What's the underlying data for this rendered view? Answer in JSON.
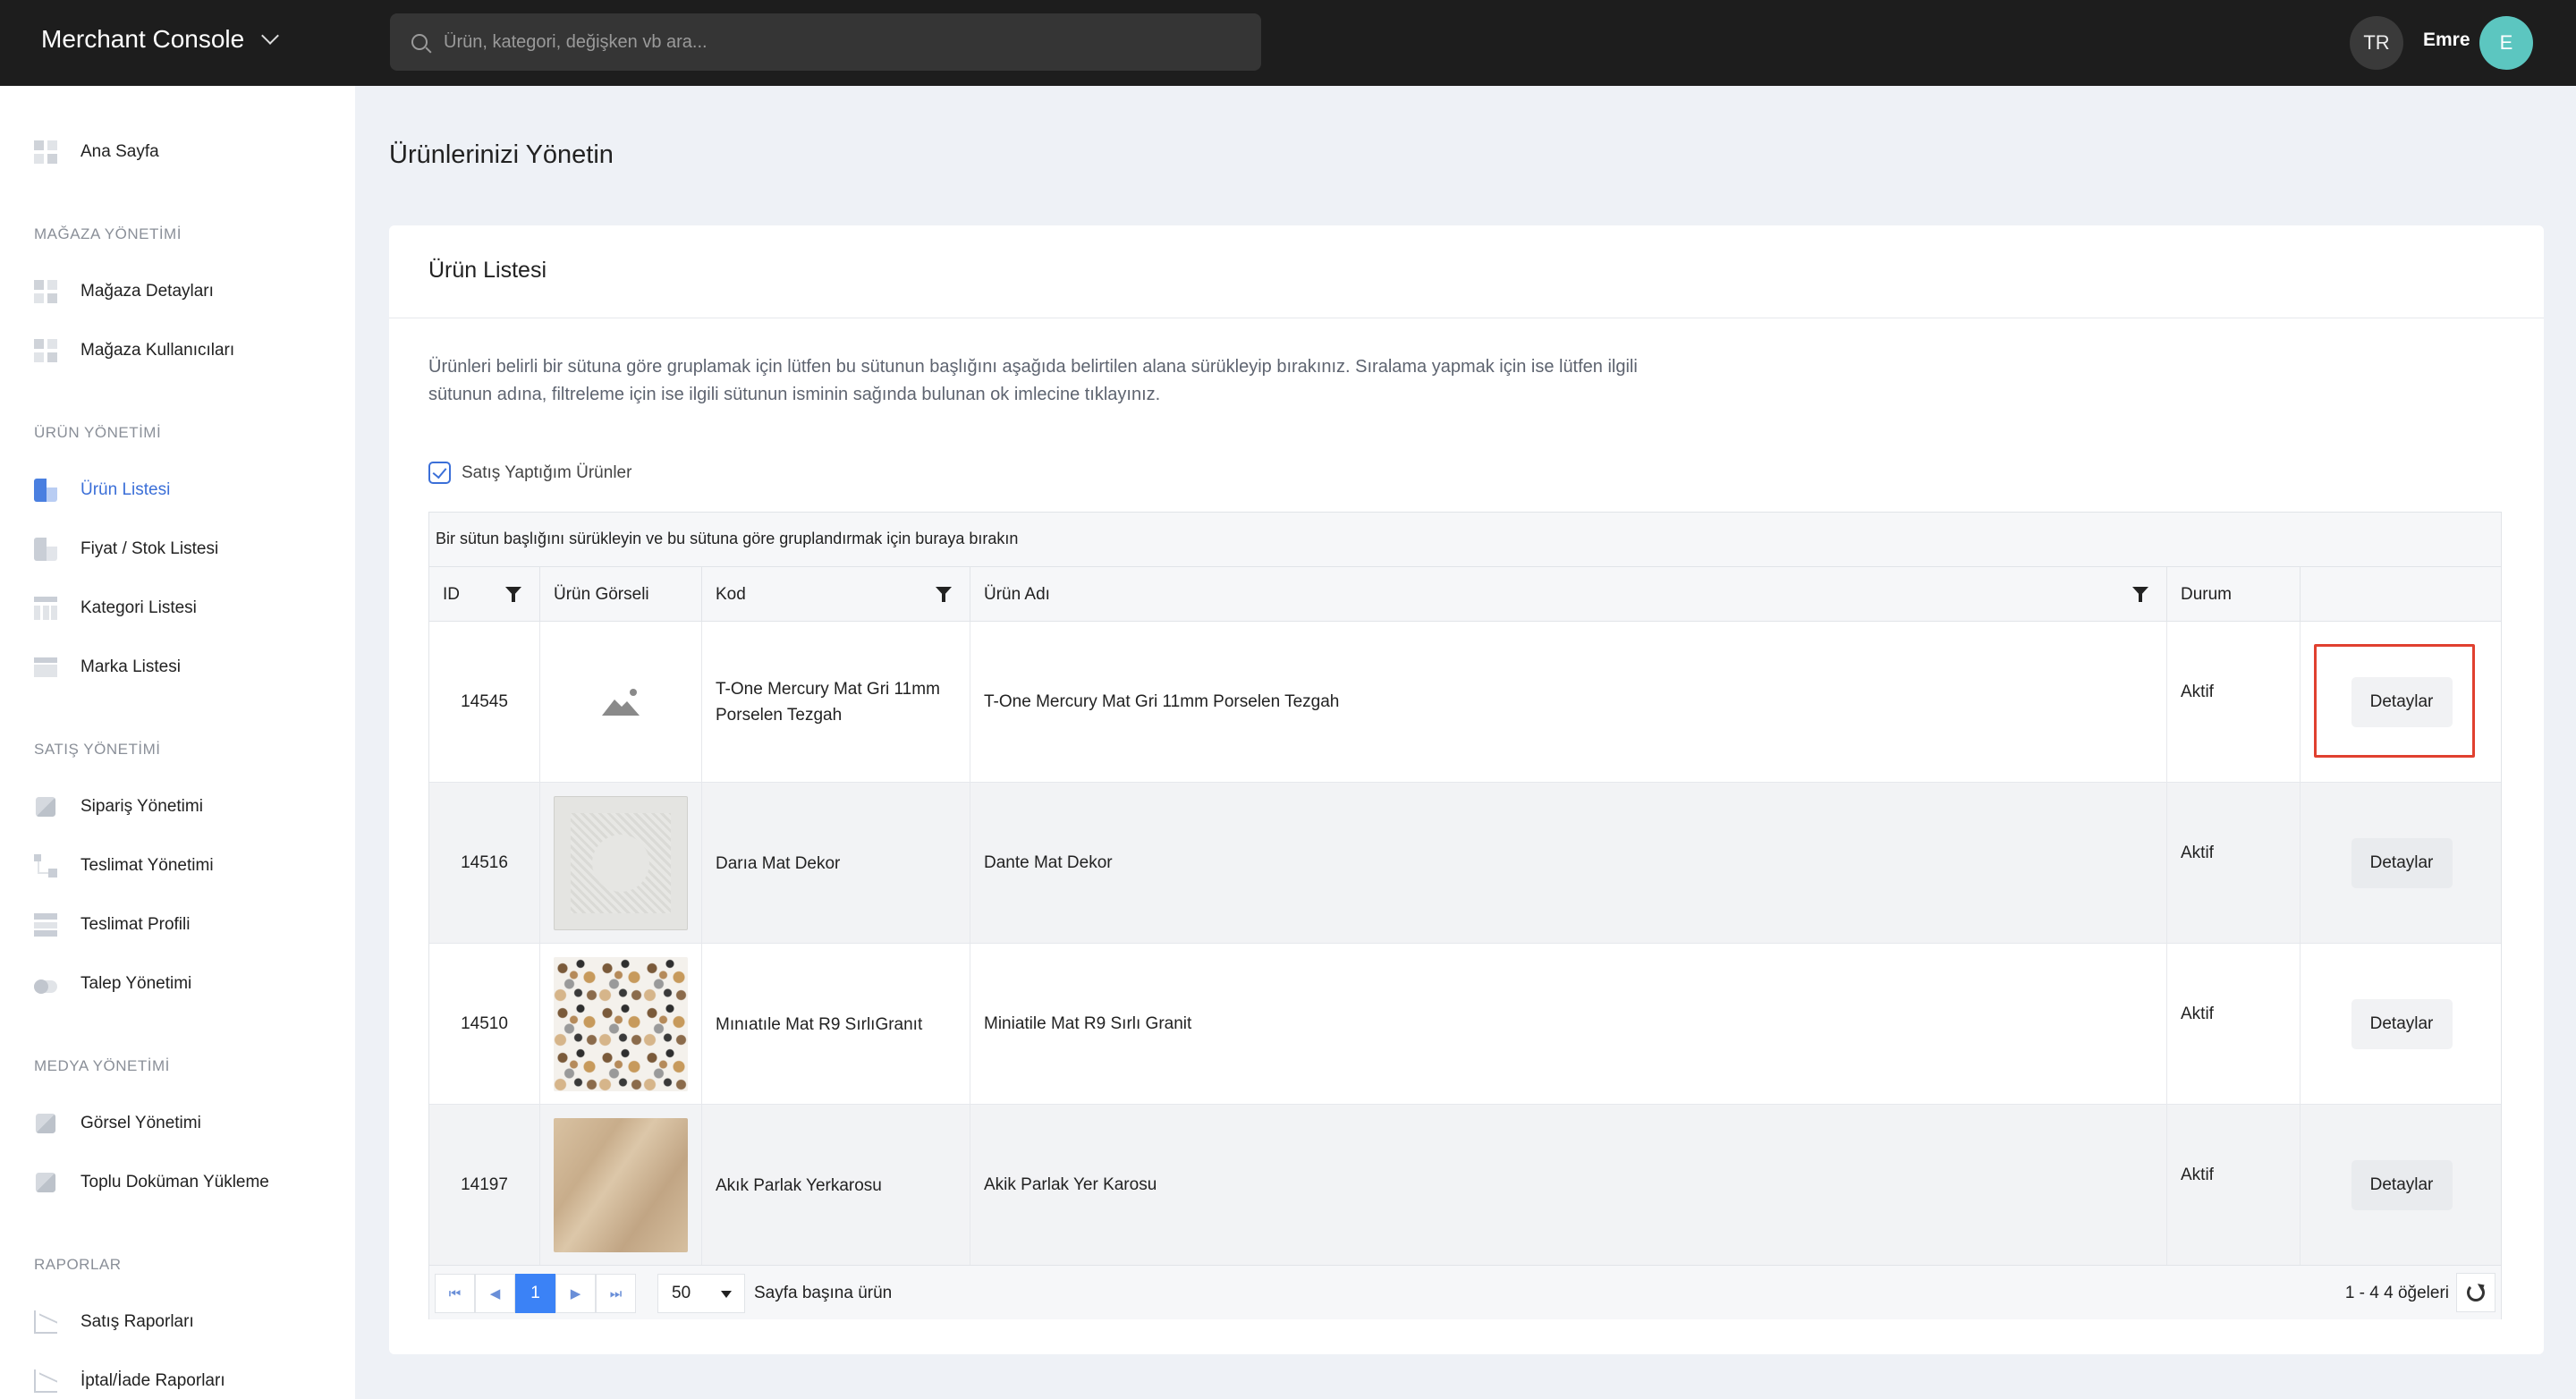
{
  "header": {
    "app_title": "Merchant Console",
    "search_placeholder": "Ürün, kategori, değişken vb ara...",
    "language": "TR",
    "user_name": "Emre",
    "avatar_initial": "E",
    "avatar_color": "#5cc6c0"
  },
  "sidebar": {
    "home": "Ana Sayfa",
    "sections": [
      {
        "title": "MAĞAZA YÖNETİMİ",
        "items": [
          "Mağaza Detayları",
          "Mağaza Kullanıcıları"
        ]
      },
      {
        "title": "ÜRÜN YÖNETİMİ",
        "items": [
          "Ürün Listesi",
          "Fiyat / Stok Listesi",
          "Kategori Listesi",
          "Marka Listesi"
        ]
      },
      {
        "title": "SATIŞ YÖNETİMİ",
        "items": [
          "Sipariş Yönetimi",
          "Teslimat Yönetimi",
          "Teslimat Profili",
          "Talep Yönetimi"
        ]
      },
      {
        "title": "MEDYA YÖNETİMİ",
        "items": [
          "Görsel Yönetimi",
          "Toplu Doküman Yükleme"
        ]
      },
      {
        "title": "RAPORLAR",
        "items": [
          "Satış Raporları",
          "İptal/İade Raporları"
        ]
      }
    ],
    "active_item": "Ürün Listesi",
    "accent_color": "#3b6fd8"
  },
  "main": {
    "page_title": "Ürünlerinizi Yönetin",
    "card_title": "Ürün Listesi",
    "description": "Ürünleri belirli bir sütuna göre gruplamak için lütfen bu sütunun başlığını aşağıda belirtilen alana sürükleyip bırakınız. Sıralama yapmak için ise lütfen ilgili sütunun adına, filtreleme için ise ilgili sütunun isminin sağında bulunan ok imlecine tıklayınız.",
    "checkbox_label": "Satış Yaptığım Ürünler",
    "checkbox_checked": true,
    "group_panel_text": "Bir sütun başlığını sürükleyin ve bu sütuna göre gruplandırmak için buraya bırakın",
    "columns": [
      "ID",
      "Ürün Görseli",
      "Kod",
      "Ürün Adı",
      "Durum",
      ""
    ],
    "rows": [
      {
        "id": "14545",
        "image": "placeholder-image-icon",
        "kod": "T-One Mercury Mat Gri 11mm Porselen Tezgah",
        "ad": "T-One Mercury Mat Gri 11mm Porselen Tezgah",
        "durum": "Aktif",
        "action": "Detaylar"
      },
      {
        "id": "14516",
        "image": "dekor-tile-thumbnail",
        "kod": "Darıa Mat Dekor",
        "ad": "Dante Mat Dekor",
        "durum": "Aktif",
        "action": "Detaylar"
      },
      {
        "id": "14510",
        "image": "terrazzo-tile-thumbnail",
        "kod": "Mınıatıle Mat R9 SırlıGranıt",
        "ad": "Miniatile Mat R9 Sırlı Granit",
        "durum": "Aktif",
        "action": "Detaylar"
      },
      {
        "id": "14197",
        "image": "marble-tile-thumbnail",
        "kod": "Akık Parlak Yerkarosu",
        "ad": "Akik Parlak Yer Karosu",
        "durum": "Aktif",
        "action": "Detaylar"
      }
    ],
    "pager": {
      "first": "⏮",
      "prev": "◀",
      "current_page": "1",
      "next": "▶",
      "last": "⏭",
      "page_size": "50",
      "page_size_label": "Sayfa başına ürün",
      "info": "1 - 4 4 öğeleri"
    },
    "highlight_color": "#e0402f"
  }
}
